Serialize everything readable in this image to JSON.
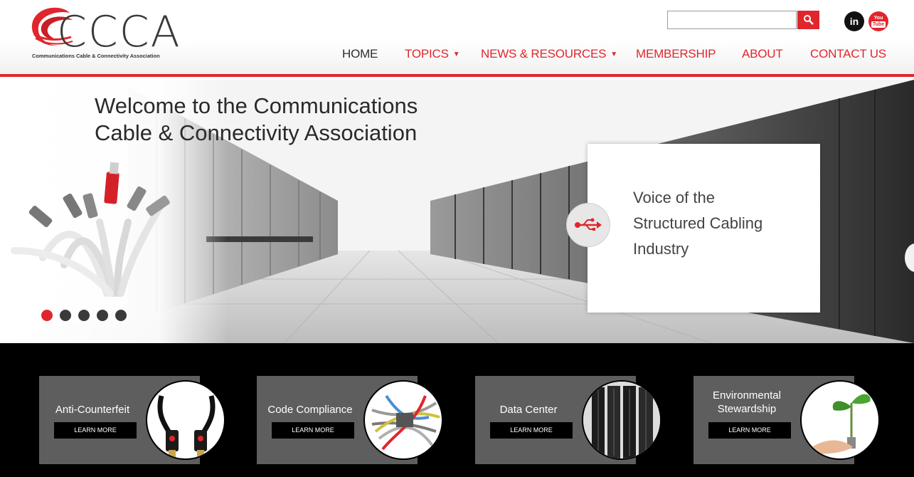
{
  "header": {
    "logo_letters": "CCCA",
    "logo_tagline": "Communications Cable & Connectivity Association",
    "search": {
      "value": "",
      "placeholder": ""
    },
    "social": [
      {
        "name": "LinkedIn",
        "glyph": "in"
      },
      {
        "name": "YouTube",
        "glyph_top": "You",
        "glyph_bottom": "Tube"
      }
    ]
  },
  "nav": {
    "items": [
      {
        "label": "HOME",
        "has_dropdown": false
      },
      {
        "label": "TOPICS",
        "has_dropdown": true
      },
      {
        "label": "NEWS & RESOURCES",
        "has_dropdown": true
      },
      {
        "label": "MEMBERSHIP",
        "has_dropdown": false
      },
      {
        "label": "ABOUT",
        "has_dropdown": false
      },
      {
        "label": "CONTACT US",
        "has_dropdown": false
      }
    ],
    "caret": "▼"
  },
  "hero": {
    "title_line1": "Welcome to the Communications",
    "title_line2": "Cable & Connectivity Association",
    "card_line1": "Voice of the",
    "card_line2": "Structured Cabling",
    "card_line3": "Industry",
    "slide_count": 5,
    "active_slide": 1
  },
  "categories": [
    {
      "title": [
        "Anti-Counterfeit"
      ],
      "button": "LEARN MORE",
      "icon": "hdmi-cables-icon"
    },
    {
      "title": [
        "Code Compliance"
      ],
      "button": "LEARN MORE",
      "icon": "cable-bundle-icon"
    },
    {
      "title": [
        "Data Center"
      ],
      "button": "LEARN MORE",
      "icon": "server-racks-icon"
    },
    {
      "title": [
        "Environmental",
        "Stewardship"
      ],
      "button": "LEARN MORE",
      "icon": "plant-sprout-icon"
    }
  ],
  "colors": {
    "accent": "#e0262d",
    "nav_text": "#e0262d",
    "card_bg": "#5e5e5e",
    "category_bar": "#000000"
  }
}
